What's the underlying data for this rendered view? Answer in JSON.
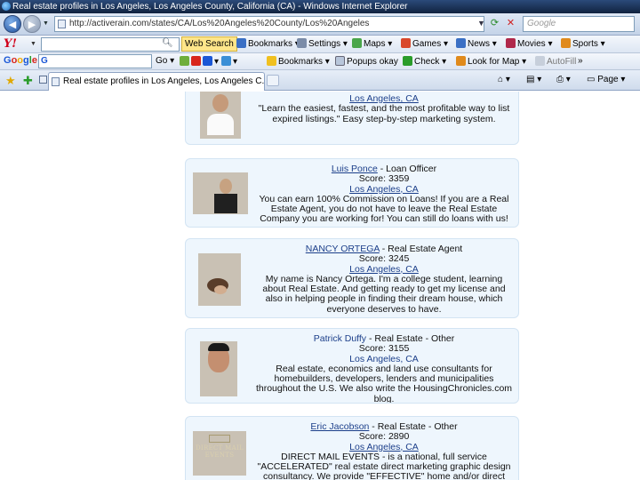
{
  "window": {
    "title": "Real estate profiles in Los Angeles, Los Angeles County, California (CA) - Windows Internet Explorer"
  },
  "address_bar": {
    "url": "http://activerain.com/states/CA/Los%20Angeles%20County/Los%20Angeles",
    "search_placeholder": "Google"
  },
  "yahoo_toolbar": {
    "logo": "Y!",
    "web_search_label": "Web Search",
    "items": [
      {
        "label": "Bookmarks",
        "color": "#3a6fc4"
      },
      {
        "label": "Settings",
        "color": "#7b8ca8"
      },
      {
        "label": "Maps",
        "color": "#4aa64a"
      },
      {
        "label": "Games",
        "color": "#d9482b"
      },
      {
        "label": "News",
        "color": "#3a6fc4"
      },
      {
        "label": "Movies",
        "color": "#b0284a"
      },
      {
        "label": "Sports",
        "color": "#e08a1c"
      }
    ]
  },
  "google_toolbar": {
    "logo": [
      "G",
      "o",
      "o",
      "g",
      "l",
      "e"
    ],
    "search_mini": "G",
    "go_label": "Go",
    "bookmarks_label": "Bookmarks",
    "popups_label": "Popups okay",
    "check_label": "Check",
    "lookfor_label": "Look for Map",
    "autofill_label": "AutoFill",
    "more_label": "»"
  },
  "tab_bar": {
    "tab_title": "Real estate profiles in Los Angeles, Los Angeles C...",
    "page_label": "Page"
  },
  "profiles": [
    {
      "name": "",
      "role": "",
      "score": "",
      "location": "Los Angeles, CA",
      "description": "\"Learn the easiest, fastest, and the most profitable way to list expired listings.\" Easy step-by-step marketing system."
    },
    {
      "name": "Luis Ponce",
      "role": " - Loan Officer",
      "score": "Score: 3359",
      "location": "Los Angeles, CA",
      "description": "You can earn 100% Commission on Loans! If you are a Real Estate Agent, you do not have to leave the Real Estate Company you are working for! You can still do loans with us!"
    },
    {
      "name": "NANCY ORTEGA",
      "role": " - Real Estate Agent",
      "score": "Score: 3245",
      "location": "Los Angeles, CA",
      "description": "My name is Nancy Ortega. I'm a college student, learning about Real Estate. And getting ready to get my license and also in helping people in finding their dream house, which everyone deserves to have."
    },
    {
      "name": "Patrick Duffy",
      "role": " - Real Estate - Other",
      "score": "Score: 3155",
      "location": "Los Angeles, CA",
      "description": "Real estate, economics and land use consultants for homebuilders, developers, lenders and municipalities throughout the U.S. We also write the HousingChronicles.com blog."
    },
    {
      "name": "Eric Jacobson",
      "role": " - Real Estate - Other",
      "score": "Score: 2890",
      "location": "Los Angeles, CA",
      "description": "DIRECT MAIL EVENTS - is a national, full service \"ACCELERATED\" real estate direct marketing graphic design consultancy. We provide \"EFFECTIVE\" home and/or direct mail",
      "photo_text": "DIRECT MAIL EVENTS"
    }
  ]
}
